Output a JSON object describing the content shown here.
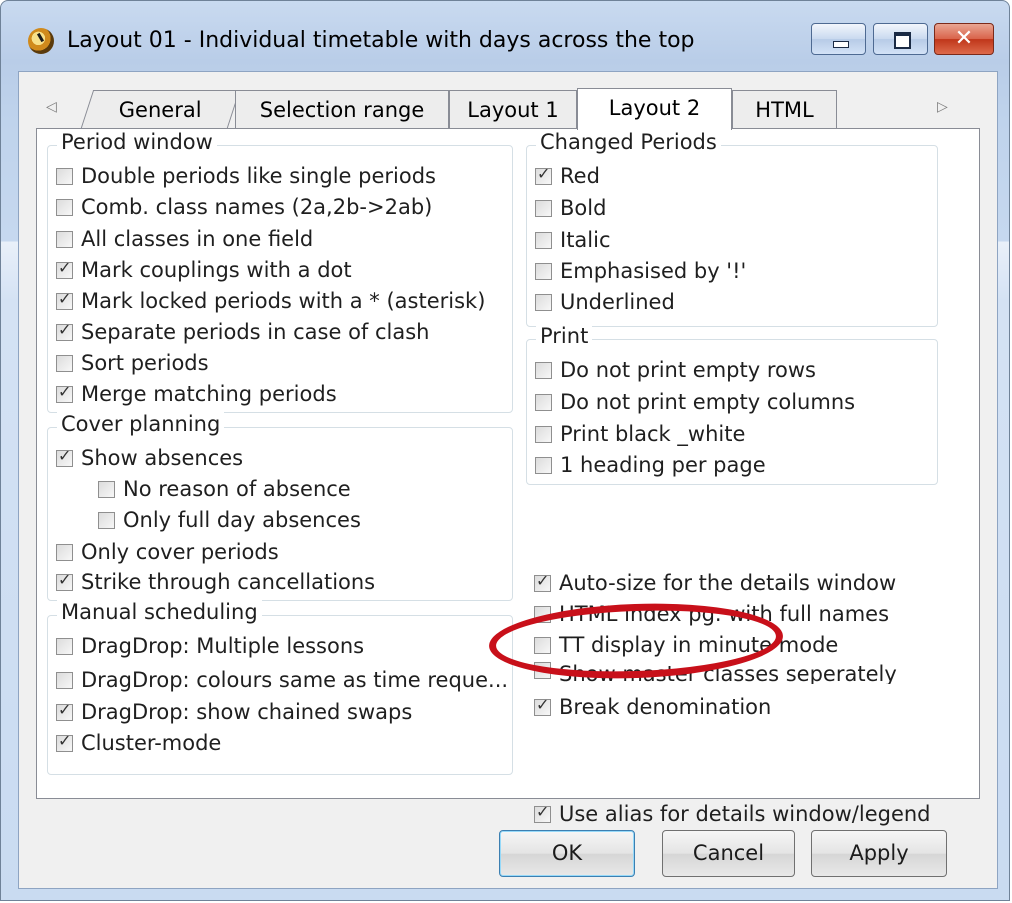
{
  "window": {
    "title": "Layout 01 - Individual timetable with days across the top"
  },
  "tabs": [
    "General",
    "Selection range",
    "Layout 1",
    "Layout 2",
    "HTML"
  ],
  "groups": {
    "period_window": {
      "title": "Period window",
      "items": [
        {
          "label": "Double periods like single periods",
          "checked": false
        },
        {
          "label": "Comb. class names (2a,2b->2ab)",
          "checked": false
        },
        {
          "label": "All classes in one field",
          "checked": false
        },
        {
          "label": "Mark couplings with a dot",
          "checked": true
        },
        {
          "label": "Mark locked periods with a * (asterisk)",
          "checked": true
        },
        {
          "label": "Separate periods in case of clash",
          "checked": true
        },
        {
          "label": "Sort periods",
          "checked": false
        },
        {
          "label": "Merge matching periods",
          "checked": true
        }
      ]
    },
    "cover_planning": {
      "title": "Cover planning",
      "items": [
        {
          "label": "Show absences",
          "checked": true
        },
        {
          "label": "No reason of absence",
          "checked": false
        },
        {
          "label": "Only full day absences",
          "checked": false
        },
        {
          "label": "Only cover periods",
          "checked": false
        },
        {
          "label": "Strike through cancellations",
          "checked": true
        }
      ]
    },
    "manual_scheduling": {
      "title": "Manual scheduling",
      "items": [
        {
          "label": "DragDrop: Multiple lessons",
          "checked": false
        },
        {
          "label": "DragDrop: colours same as time reque...",
          "checked": false
        },
        {
          "label": "DragDrop: show chained swaps",
          "checked": true
        },
        {
          "label": "Cluster-mode",
          "checked": true
        }
      ]
    },
    "changed_periods": {
      "title": "Changed Periods",
      "items": [
        {
          "label": "Red",
          "checked": true
        },
        {
          "label": "Bold",
          "checked": false
        },
        {
          "label": "Italic",
          "checked": false
        },
        {
          "label": "Emphasised by '!'",
          "checked": false
        },
        {
          "label": "Underlined",
          "checked": false
        }
      ]
    },
    "print": {
      "title": "Print",
      "items": [
        {
          "label": "Do not print empty rows",
          "checked": false
        },
        {
          "label": "Do not print empty columns",
          "checked": false
        },
        {
          "label": "Print black _white",
          "checked": false
        },
        {
          "label": "1 heading per page",
          "checked": false
        }
      ]
    }
  },
  "extras": [
    {
      "label": "Auto-size for the details window",
      "checked": true
    },
    {
      "label": "HTML index pg. with full names",
      "checked": false
    },
    {
      "label": "TT display in minute mode",
      "checked": false
    },
    {
      "label": "Show master classes seperately",
      "checked": false
    },
    {
      "label": "Break denomination",
      "checked": true
    },
    {
      "label": "Use alias for details window/legend",
      "checked": true
    }
  ],
  "buttons": {
    "ok": "OK",
    "cancel": "Cancel",
    "apply": "Apply"
  },
  "window_buttons": {
    "close": "✕"
  }
}
